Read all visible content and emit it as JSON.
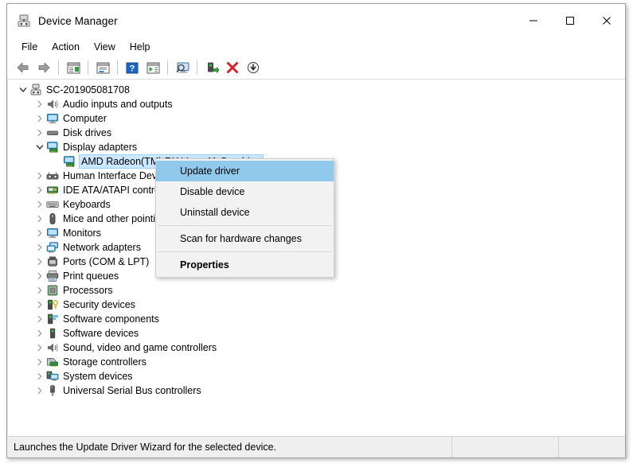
{
  "window": {
    "title": "Device Manager",
    "icon": "device-manager-icon",
    "controls": [
      {
        "name": "minimize",
        "glyph": "—"
      },
      {
        "name": "maximize",
        "glyph": "□"
      },
      {
        "name": "close",
        "glyph": "✕"
      }
    ]
  },
  "menubar": {
    "items": [
      {
        "label": "File"
      },
      {
        "label": "Action"
      },
      {
        "label": "View"
      },
      {
        "label": "Help"
      }
    ]
  },
  "toolbar": {
    "buttons": [
      {
        "name": "back-button",
        "icon": "back-arrow-icon"
      },
      {
        "name": "forward-button",
        "icon": "forward-arrow-icon"
      },
      {
        "name": "separator-1",
        "icon": "separator"
      },
      {
        "name": "show-hide-console-tree-button",
        "icon": "console-tree-icon"
      },
      {
        "name": "separator-2",
        "icon": "separator"
      },
      {
        "name": "properties-button",
        "icon": "properties-window-icon"
      },
      {
        "name": "separator-3",
        "icon": "separator"
      },
      {
        "name": "help-button",
        "icon": "question-mark-icon"
      },
      {
        "name": "show-hide-action-pane-button",
        "icon": "action-pane-icon"
      },
      {
        "name": "separator-4",
        "icon": "separator"
      },
      {
        "name": "scan-for-hardware-changes-button",
        "icon": "scan-monitor-icon"
      },
      {
        "name": "separator-5",
        "icon": "separator"
      },
      {
        "name": "update-driver-button",
        "icon": "update-driver-icon"
      },
      {
        "name": "uninstall-device-button",
        "icon": "red-x-icon"
      },
      {
        "name": "disable-device-button",
        "icon": "down-arrow-circle-icon"
      }
    ]
  },
  "tree": {
    "root": {
      "label": "SC-201905081708",
      "icon": "computer-root-icon",
      "expanded": true
    },
    "nodes": [
      {
        "label": "Audio inputs and outputs",
        "icon": "speaker-icon",
        "expandable": true,
        "expanded": false,
        "level": 1
      },
      {
        "label": "Computer",
        "icon": "monitor-icon",
        "expandable": true,
        "expanded": false,
        "level": 1
      },
      {
        "label": "Disk drives",
        "icon": "disk-drive-icon",
        "expandable": true,
        "expanded": false,
        "level": 1
      },
      {
        "label": "Display adapters",
        "icon": "display-adapter-icon",
        "expandable": true,
        "expanded": true,
        "level": 1
      },
      {
        "label": "AMD Radeon(TM) RX Vega 11 Graphics",
        "icon": "display-adapter-icon",
        "expandable": false,
        "expanded": false,
        "level": 2,
        "selected": true
      },
      {
        "label": "Human Interface Devices",
        "icon": "hid-icon",
        "expandable": true,
        "expanded": false,
        "level": 1
      },
      {
        "label": "IDE ATA/ATAPI controllers",
        "icon": "ide-controller-icon",
        "expandable": true,
        "expanded": false,
        "level": 1
      },
      {
        "label": "Keyboards",
        "icon": "keyboard-icon",
        "expandable": true,
        "expanded": false,
        "level": 1
      },
      {
        "label": "Mice and other pointing devices",
        "icon": "mouse-icon",
        "expandable": true,
        "expanded": false,
        "level": 1
      },
      {
        "label": "Monitors",
        "icon": "monitor-icon",
        "expandable": true,
        "expanded": false,
        "level": 1
      },
      {
        "label": "Network adapters",
        "icon": "network-adapter-icon",
        "expandable": true,
        "expanded": false,
        "level": 1
      },
      {
        "label": "Ports (COM & LPT)",
        "icon": "port-icon",
        "expandable": true,
        "expanded": false,
        "level": 1
      },
      {
        "label": "Print queues",
        "icon": "printer-icon",
        "expandable": true,
        "expanded": false,
        "level": 1
      },
      {
        "label": "Processors",
        "icon": "processor-icon",
        "expandable": true,
        "expanded": false,
        "level": 1
      },
      {
        "label": "Security devices",
        "icon": "security-key-icon",
        "expandable": true,
        "expanded": false,
        "level": 1
      },
      {
        "label": "Software components",
        "icon": "software-component-icon",
        "expandable": true,
        "expanded": false,
        "level": 1
      },
      {
        "label": "Software devices",
        "icon": "software-device-icon",
        "expandable": true,
        "expanded": false,
        "level": 1
      },
      {
        "label": "Sound, video and game controllers",
        "icon": "speaker-icon",
        "expandable": true,
        "expanded": false,
        "level": 1
      },
      {
        "label": "Storage controllers",
        "icon": "storage-controller-icon",
        "expandable": true,
        "expanded": false,
        "level": 1
      },
      {
        "label": "System devices",
        "icon": "system-device-icon",
        "expandable": true,
        "expanded": false,
        "level": 1
      },
      {
        "label": "Universal Serial Bus controllers",
        "icon": "usb-icon",
        "expandable": true,
        "expanded": false,
        "level": 1
      }
    ]
  },
  "context_menu": {
    "items": [
      {
        "label": "Update driver",
        "highlighted": true,
        "bold": false,
        "separator_after": false
      },
      {
        "label": "Disable device",
        "highlighted": false,
        "bold": false,
        "separator_after": false
      },
      {
        "label": "Uninstall device",
        "highlighted": false,
        "bold": false,
        "separator_after": true
      },
      {
        "label": "Scan for hardware changes",
        "highlighted": false,
        "bold": false,
        "separator_after": true
      },
      {
        "label": "Properties",
        "highlighted": false,
        "bold": true,
        "separator_after": false
      }
    ]
  },
  "statusbar": {
    "message": "Launches the Update Driver Wizard for the selected device.",
    "panel_mid": "",
    "panel_end": ""
  },
  "colors": {
    "menu_highlight": "#91c9ec",
    "tree_selection": "#cce8ff",
    "statusbar_bg": "#efefef",
    "window_border": "#a0a0a0"
  }
}
